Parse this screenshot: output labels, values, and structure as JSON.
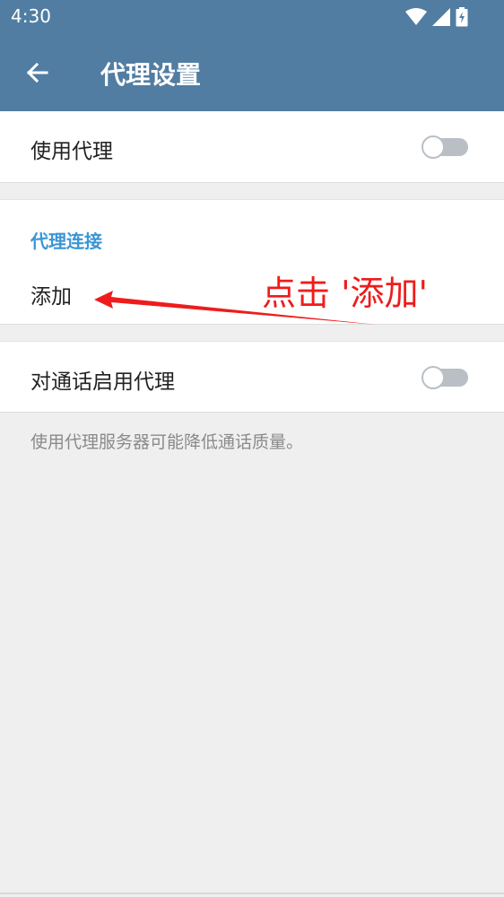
{
  "status_bar": {
    "time": "4:30",
    "icons": [
      "wifi-icon",
      "signal-icon",
      "battery-icon"
    ]
  },
  "app_bar": {
    "title": "代理设置",
    "back_icon": "arrow-left-icon"
  },
  "use_proxy": {
    "label": "使用代理",
    "enabled": false
  },
  "proxy_connection": {
    "header": "代理连接",
    "add_label": "添加"
  },
  "calls_proxy": {
    "label": "对通话启用代理",
    "enabled": false
  },
  "footnote": "使用代理服务器可能降低通话质量。",
  "annotation": {
    "text": "点击 '添加'",
    "color": "#ee1c1c"
  },
  "colors": {
    "app_bar": "#517da2",
    "section_header": "#3a95d5",
    "background": "#efefef"
  }
}
